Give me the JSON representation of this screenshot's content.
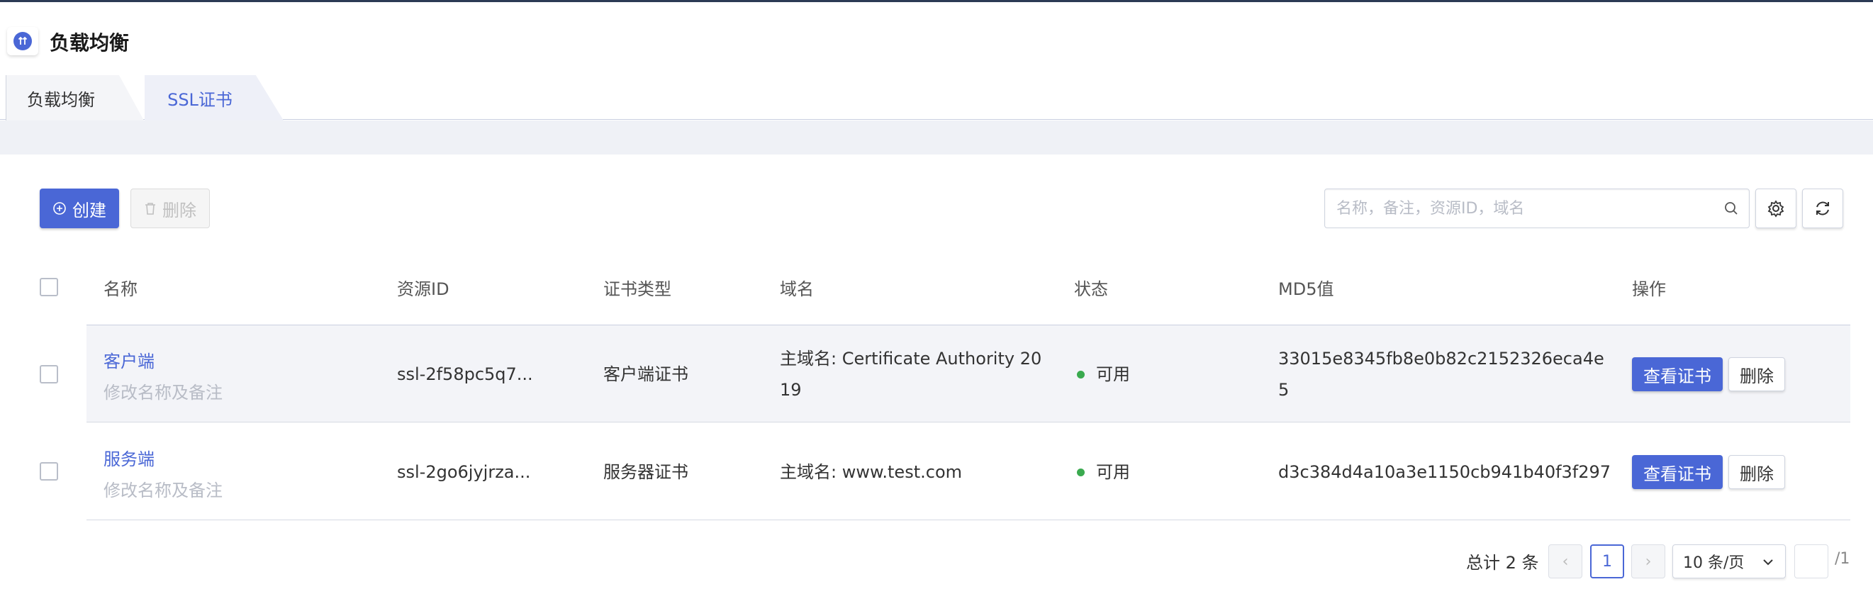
{
  "header": {
    "title": "负载均衡",
    "icon": "load-balancer-icon"
  },
  "tabs": [
    {
      "label": "负载均衡",
      "active": false
    },
    {
      "label": "SSL证书",
      "active": true
    }
  ],
  "toolbar": {
    "create_label": "创建",
    "delete_label": "删除",
    "search_placeholder": "名称，备注，资源ID，域名"
  },
  "table": {
    "headers": [
      "名称",
      "资源ID",
      "证书类型",
      "域名",
      "状态",
      "MD5值",
      "操作"
    ],
    "rows": [
      {
        "name": "客户端",
        "note": "修改名称及备注",
        "resource_id": "ssl-2f58pc5q7...",
        "cert_type": "客户端证书",
        "domain_line1": "主域名: Certificate Authority 20",
        "domain_line2": "19",
        "status": "可用",
        "md5_line1": "33015e8345fb8e0b82c2152326eca4e",
        "md5_line2": "5",
        "view_label": "查看证书",
        "delete_label": "删除"
      },
      {
        "name": "服务端",
        "note": "修改名称及备注",
        "resource_id": "ssl-2go6jyjrza...",
        "cert_type": "服务器证书",
        "domain_line1": "主域名: www.test.com",
        "status": "可用",
        "md5_line1": "d3c384d4a10a3e1150cb941b40f3f297",
        "view_label": "查看证书",
        "delete_label": "删除"
      }
    ]
  },
  "pagination": {
    "total_text": "总计 2 条",
    "current_page": "1",
    "page_size": "10 条/页",
    "total_pages": "/1"
  },
  "colors": {
    "accent": "#4a67d6",
    "status_ok": "#3aaa4f"
  }
}
